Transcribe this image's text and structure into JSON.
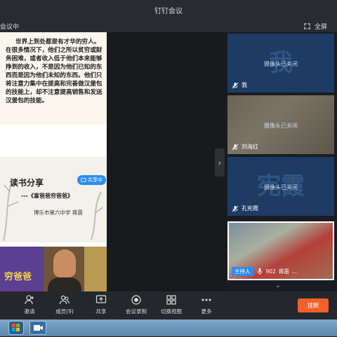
{
  "window": {
    "title": "钉钉会议"
  },
  "topbar": {
    "left_text": "会议中",
    "fullscreen_label": "全屏"
  },
  "shared_screen": {
    "doc_text": "世界上到处都是有才华的穷人。在很多情况下，他们之所以贫穷或财务困难，或者收入低于他们本来能够挣到的收入，不是因为他们已知的东西而是因为他们未知的东西。他们只将注意力集中在提高和完善做汉堡包的技能上，却不注意提高销售和发送汉堡包的技能。",
    "slide_title": "读书分享",
    "slide_subtitle": "---《富爸爸穷爸爸》",
    "slide_school": "博乐市第六中学  蒋霞",
    "sharing_badge": "共享中",
    "book1_text": "穷爸爸"
  },
  "participants": [
    {
      "big_name": "我",
      "status": "摄像头已关闭",
      "name": "我"
    },
    {
      "status": "摄像头已关闭",
      "name": "刘海红"
    },
    {
      "big_name": "宪霞",
      "status": "摄像头已关闭",
      "name": "孔宪霞"
    },
    {
      "host_tag": "主持人",
      "name_prefix": "902",
      "name": "蒋霞",
      "more": "..."
    }
  ],
  "toolbar": {
    "invite": "邀请",
    "members": "成员(9)",
    "share": "共享",
    "record": "会议录制",
    "switch_view": "切换视图",
    "more": "更多",
    "hangup": "挂断"
  }
}
